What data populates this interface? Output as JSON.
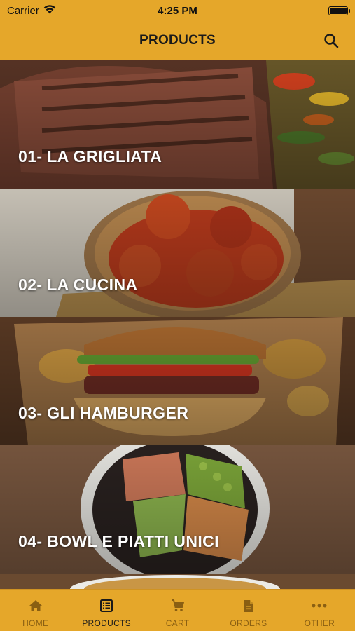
{
  "status_bar": {
    "carrier": "Carrier",
    "time": "4:25 PM"
  },
  "nav": {
    "title": "PRODUCTS",
    "search_icon": "search-icon"
  },
  "categories": [
    {
      "label": "01- LA GRIGLIATA"
    },
    {
      "label": "02- LA CUCINA"
    },
    {
      "label": "03- GLI HAMBURGER"
    },
    {
      "label": "04- BOWL E PIATTI UNICI"
    }
  ],
  "tabs": [
    {
      "label": "HOME",
      "icon": "home-icon",
      "active": false
    },
    {
      "label": "PRODUCTS",
      "icon": "products-icon",
      "active": true
    },
    {
      "label": "CART",
      "icon": "cart-icon",
      "active": false
    },
    {
      "label": "ORDERS",
      "icon": "orders-icon",
      "active": false
    },
    {
      "label": "OTHER",
      "icon": "more-icon",
      "active": false
    }
  ],
  "colors": {
    "accent": "#e5a72a",
    "active_tab": "#1a1a1a",
    "inactive_tab": "#8a5f12",
    "label": "#ffffff"
  }
}
